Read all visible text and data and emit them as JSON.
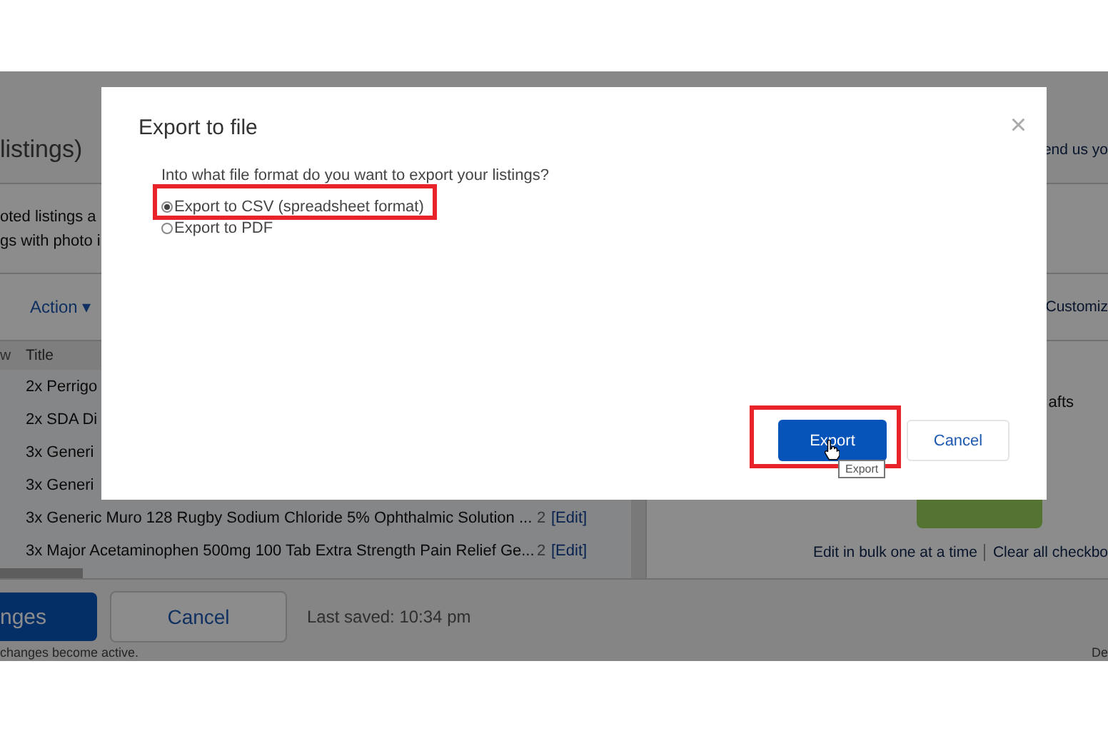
{
  "background_page": {
    "heading": "listings)",
    "right_link": "end us yo",
    "notes": [
      "oted listings a",
      "gs with photo i"
    ],
    "action_menu": "Action",
    "action_caret": "▾",
    "customize_link": "Customiz",
    "table": {
      "columns": [
        "w",
        "Title"
      ],
      "rows": [
        {
          "title": "2x Perrigo"
        },
        {
          "title": "2x SDA Di"
        },
        {
          "title": "3x Generi"
        },
        {
          "title": "3x Generi"
        },
        {
          "title": "3x Generic Muro 128 Rugby Sodium Chloride 5% Ophthalmic Solution ...",
          "column_3": "2",
          "edit": "[Edit]"
        },
        {
          "title": "3x Major Acetaminophen 500mg 100 Tab Extra Strength Pain Relief Ge...",
          "column_3": "2",
          "edit": "[Edit]"
        }
      ]
    },
    "drafts_text": "afts",
    "bulk_links": [
      "Edit in bulk one at a time",
      "Clear all checkbo"
    ],
    "footer": {
      "save_button": "nges",
      "cancel_button": "Cancel",
      "last_saved": "Last saved: 10:34 pm",
      "note": "changes become active.",
      "corner_text": "De"
    }
  },
  "dialog": {
    "title": "Export to file",
    "close": "×",
    "question": "Into what file format do you want to export your listings?",
    "options": [
      {
        "label": "Export to CSV (spreadsheet format)",
        "selected": true,
        "highlighted": true
      },
      {
        "label": "Export to PDF",
        "selected": false,
        "highlighted": false
      }
    ],
    "buttons": [
      {
        "label": "Export",
        "kind": "primary",
        "highlighted": true
      },
      {
        "label": "Cancel",
        "kind": "secondary",
        "highlighted": false
      }
    ],
    "tooltip": "Export"
  }
}
